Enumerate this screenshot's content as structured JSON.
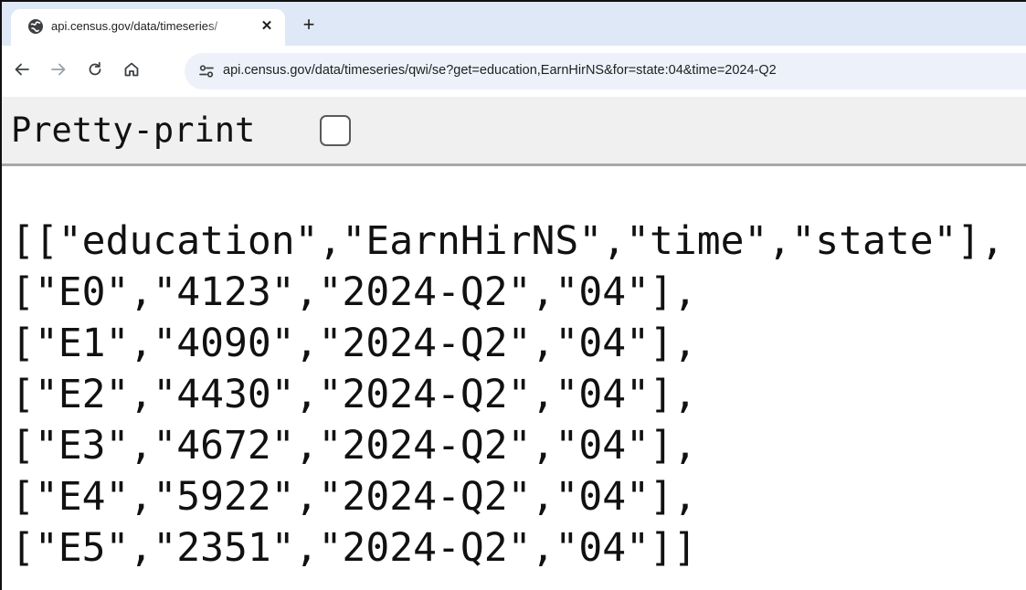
{
  "tab": {
    "title": "api.census.gov/data/timeseries/",
    "favicon": "globe-icon",
    "close_icon": "close-icon"
  },
  "toolbar": {
    "back_icon": "back-arrow-icon",
    "forward_icon": "forward-arrow-icon",
    "reload_icon": "reload-icon",
    "home_icon": "home-icon",
    "site_info_icon": "tune-icon",
    "url": "api.census.gov/data/timeseries/qwi/se?get=education,EarnHirNS&for=state:04&time=2024-Q2"
  },
  "pretty_print": {
    "label": "Pretty-print",
    "checked": false
  },
  "json_lines": [
    "[[\"education\",\"EarnHirNS\",\"time\",\"state\"],",
    "[\"E0\",\"4123\",\"2024-Q2\",\"04\"],",
    "[\"E1\",\"4090\",\"2024-Q2\",\"04\"],",
    "[\"E2\",\"4430\",\"2024-Q2\",\"04\"],",
    "[\"E3\",\"4672\",\"2024-Q2\",\"04\"],",
    "[\"E4\",\"5922\",\"2024-Q2\",\"04\"],",
    "[\"E5\",\"2351\",\"2024-Q2\",\"04\"]]"
  ],
  "colors": {
    "tabstrip_bg": "#dfe8f6",
    "omnibox_bg": "#edf2fa",
    "pretty_print_bg": "#f0f0f0"
  }
}
